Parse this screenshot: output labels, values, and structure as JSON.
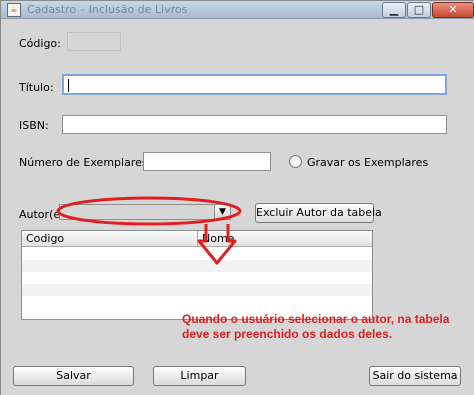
{
  "window": {
    "title": "Cadastro – Inclusão de Livros",
    "min_glyph": "▁",
    "max_glyph": "□",
    "close_glyph": "✕",
    "icon_text": "☕"
  },
  "form": {
    "codigo_label": "Código:",
    "titulo_label": "Título:",
    "titulo_value": "",
    "isbn_label": "ISBN:",
    "isbn_value": "",
    "exemplares_label": "Número de Exemplares:",
    "exemplares_value": "",
    "gravar_label": "Gravar os Exemplares",
    "autor_label": "Autor(es",
    "autor_selected": "",
    "excluir_label": "Excluir Autor da tabela",
    "table_headers": [
      "Codigo",
      "Nome"
    ],
    "table_rows": []
  },
  "annotation": {
    "text": "Quando o usuário selecionar o autor, na tabela deve ser preenchido os dados deles.",
    "color": "#e02020"
  },
  "buttons": {
    "salvar": "Salvar",
    "limpar": "Limpar",
    "sair": "Sair do sistema"
  },
  "colors": {
    "window_bg": "#d6d6d6",
    "focus_border": "#7fa7d9",
    "markup_red": "#e02020"
  },
  "icons": {
    "combo_arrow": "▼"
  }
}
